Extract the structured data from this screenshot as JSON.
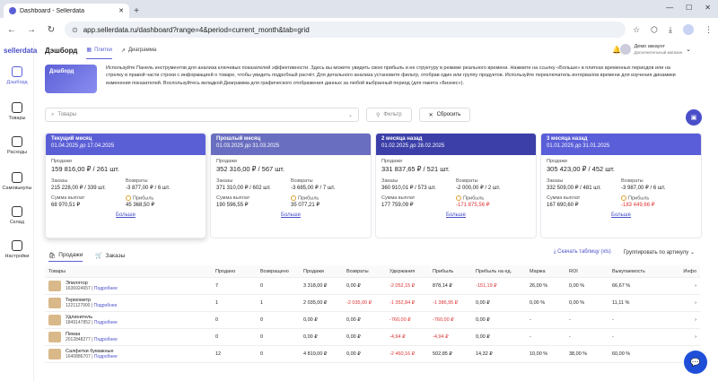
{
  "browser": {
    "tab_title": "Dashboard - Sellerdata",
    "url": "app.sellerdata.ru/dashboard?range=4&period=current_month&tab=grid"
  },
  "app": {
    "logo": "sellerdata",
    "title": "Дэшборд",
    "view_tabs": [
      "Плитки",
      "Диаграмма"
    ],
    "user": {
      "name": "Демо аккаунт",
      "sub": "Дополнительный магазин"
    }
  },
  "sidebar": [
    "Дэшборд",
    "Товары",
    "Расходы",
    "Самовыкупы",
    "Склад",
    "Настройки"
  ],
  "banner": {
    "img_text": "Дэшборд",
    "text": "Используйте Панель инструментов для анализа ключевых показателей эффективности. Здесь вы можете увидеть свою прибыль и ее структуру в режиме реального времени. Нажмите на ссылку «Больше» в плитках временных периодов или на стрелку в правой части строки с информацией о товаре, чтобы увидеть подробный расчёт. Для детального анализа установите фильтр, отобрав один или группу продуктов. Используйте переключатель интервалов времени для изучения динамики изменения показателей. Воспользуйтесь вкладкой Диаграмма для графического отображения данных за любой выбранный период (для пакета «Бизнес»)."
  },
  "filters": {
    "search_placeholder": "Товары",
    "filter": "Фильтр",
    "reset": "Сбросить"
  },
  "cards": [
    {
      "period": "Текущий месяц",
      "dates": "01.04.2025 до 17.04.2025",
      "color": "#5b5fd6",
      "sales": "159 816,00 ₽ / 261 шт.",
      "orders": "215 228,00 ₽ / 339 шт.",
      "returns": "-3 877,00 ₽ / 6 шт.",
      "payout": "68 970,51 ₽",
      "profit": "45 368,50 ₽"
    },
    {
      "period": "Прошлый месяц",
      "dates": "01.03.2025 до 31.03.2025",
      "color": "#6a6ec0",
      "sales": "352 316,00 ₽ / 567 шт.",
      "orders": "371 310,00 ₽ / 602 шт.",
      "returns": "-3 685,00 ₽ / 7 шт.",
      "payout": "190 596,55 ₽",
      "profit": "35 077,21 ₽"
    },
    {
      "period": "2 месяца назад",
      "dates": "01.02.2025 до 28.02.2025",
      "color": "#3c3fa8",
      "sales": "331 837,65 ₽ / 521 шт.",
      "orders": "360 910,01 ₽ / 573 шт.",
      "returns": "-2 000,00 ₽ / 2 шт.",
      "payout": "177 759,09 ₽",
      "profit": "-171 875,56 ₽"
    },
    {
      "period": "3 месяца назад",
      "dates": "01.01.2025 до 31.01.2025",
      "color": "#5a5ed8",
      "sales": "305 423,00 ₽ / 452 шт.",
      "orders": "332 509,00 ₽ / 481 шт.",
      "returns": "-3 987,00 ₽ / 6 шт.",
      "payout": "167 690,60 ₽",
      "profit": "-183 449,66 ₽"
    }
  ],
  "card_labels": {
    "sales": "Продажи",
    "orders": "Заказы",
    "returns": "Возвраты",
    "payout": "Сумма выплат",
    "profit": "Прибыль",
    "more": "Больше"
  },
  "table_tabs": [
    "Продажи",
    "Заказы"
  ],
  "table_tools": {
    "download": "Скачать таблицу (xls)",
    "group": "Группировать по артикулу"
  },
  "columns": [
    "Товары",
    "Продано",
    "Возвращено",
    "Продажи",
    "Возвраты",
    "Удержания",
    "Прибыль",
    "Прибыль на ед.",
    "Маржа",
    "ROI",
    "Выкупаемость",
    "Инфо"
  ],
  "rows": [
    {
      "name": "Эпилятор",
      "sku": "1636924657",
      "more": "Подробнее",
      "v": [
        "7",
        "0",
        "3 318,00 ₽",
        "0,00 ₽",
        "-2 052,15 ₽",
        "878,14 ₽",
        "-151,19 ₽",
        "26,00 %",
        "0,00 %",
        "66,67 %"
      ]
    },
    {
      "name": "Термометр",
      "sku": "1221127900",
      "more": "Подробнее",
      "v": [
        "1",
        "1",
        "2 035,00 ₽",
        "-2 035,00 ₽",
        "-1 352,84 ₽",
        "-1 386,95 ₽",
        "0,00 ₽",
        "0,00 %",
        "0,00 %",
        "11,11 %"
      ]
    },
    {
      "name": "Удлинитель",
      "sku": "1849147852",
      "more": "Подробнее",
      "v": [
        "0",
        "0",
        "0,00 ₽",
        "0,00 ₽",
        "-760,00 ₽",
        "-760,00 ₽",
        "0,00 ₽",
        "-",
        "-",
        "-"
      ]
    },
    {
      "name": "Пемза",
      "sku": "2012848277",
      "more": "Подробнее",
      "v": [
        "0",
        "0",
        "0,00 ₽",
        "0,00 ₽",
        "-4,94 ₽",
        "-4,94 ₽",
        "0,00 ₽",
        "-",
        "-",
        "-"
      ]
    },
    {
      "name": "Салфетки бумажные",
      "sku": "1640886707",
      "more": "Подробнее",
      "v": [
        "12",
        "0",
        "4 819,00 ₽",
        "0,00 ₽",
        "-2 460,16 ₽",
        "502,85 ₽",
        "14,32 ₽",
        "10,00 %",
        "38,00 %",
        "60,00 %"
      ]
    }
  ]
}
